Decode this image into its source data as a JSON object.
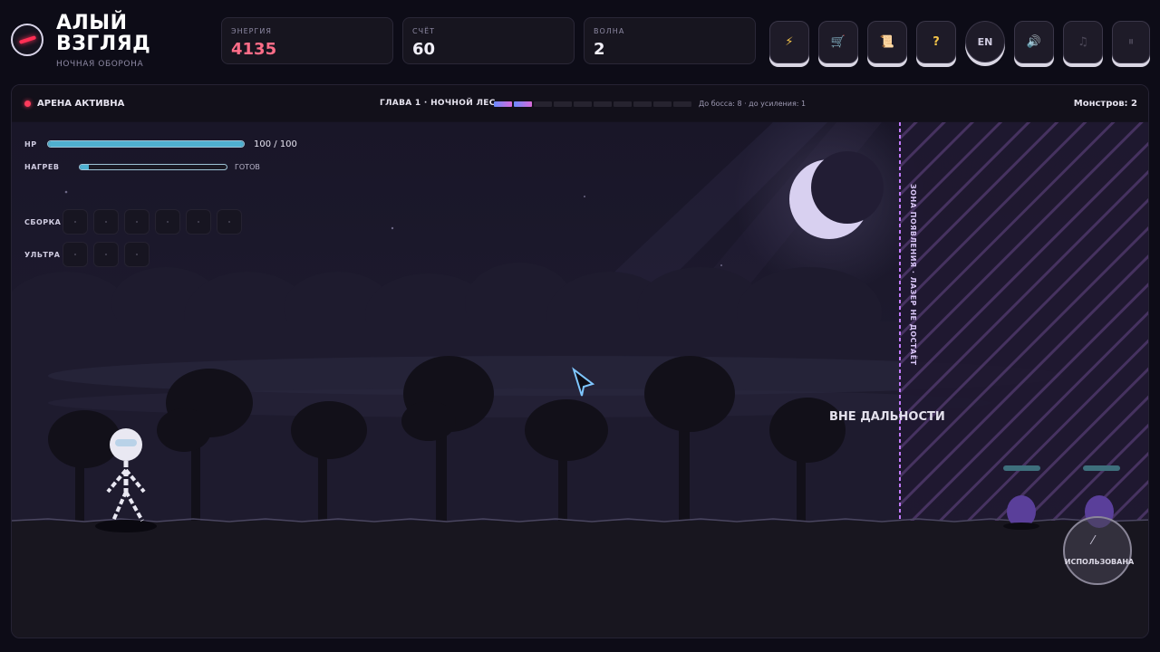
{
  "header": {
    "logo_title": "АЛЫЙ\nВЗГЛЯД",
    "logo_subtitle": "НОЧНАЯ ОБОРОНА",
    "stats": [
      {
        "label": "ЭНЕРГИЯ",
        "value": "4135"
      },
      {
        "label": "СЧЁТ",
        "value": "60"
      },
      {
        "label": "ВОЛНА",
        "value": "2"
      }
    ],
    "toolbar": {
      "power_icon": "⚡",
      "shop_icon": "🛒",
      "scroll_icon": "📜",
      "help_icon": "?",
      "lang_label": "EN",
      "sound_icon": "🔊",
      "music_icon": "♫",
      "pause_icon": "⏸"
    }
  },
  "arena": {
    "status": "АРЕНА АКТИВНА",
    "chapter": "ГЛАВА 1 · НОЧНОЙ ЛЕС",
    "progress": {
      "segments": 10,
      "filled": 2
    },
    "boss_info": "До босса: 8 · до усиления: 1",
    "monsters": "Монстров: 2"
  },
  "hud": {
    "hp_label": "HP",
    "hp_value": "100 / 100",
    "hp_fraction": 1.0,
    "heat_label": "НАГРЕВ",
    "heat_status": "ГОТОВ",
    "heat_fraction": 0.06,
    "build_label": "СБОРКА",
    "build_slots": 6,
    "ultra_label": "УЛЬТРА",
    "ultra_slots": 3
  },
  "scene": {
    "out_of_range": "ВНЕ ДАЛЬНОСТИ",
    "spawn_zone": "ЗОНА ПОЯВЛЕНИЯ · ЛАЗЕР НЕ ДОСТАЁТ",
    "use_button": "ИСПОЛЬЗОВАНА",
    "colors": {
      "accent": "#ff2f55",
      "energy": "#ff6d88",
      "hp": "#4fb0d0",
      "zone": "#c27bff"
    }
  }
}
